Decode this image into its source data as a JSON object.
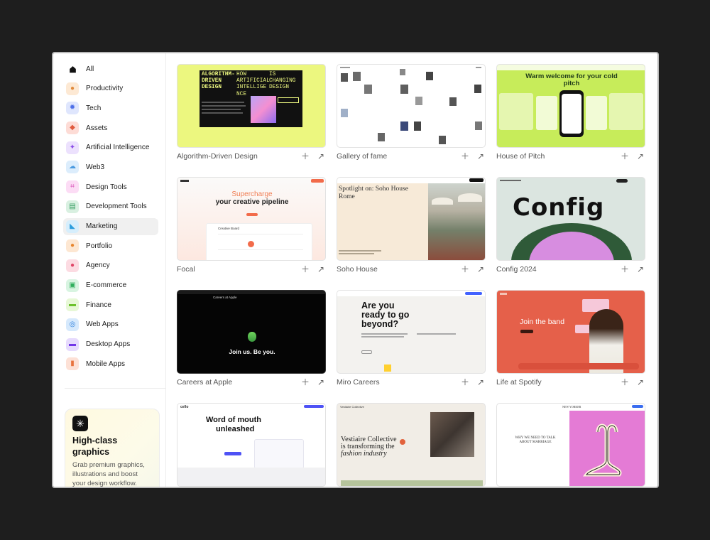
{
  "sidebar": {
    "categories": [
      {
        "label": "All",
        "icon": "home-icon",
        "color": "#111111"
      },
      {
        "label": "Productivity",
        "icon": "person-icon",
        "color": "#f6c08a"
      },
      {
        "label": "Tech",
        "icon": "chip-icon",
        "color": "#8fa8f5"
      },
      {
        "label": "Assets",
        "icon": "cube-icon",
        "color": "#f29a88"
      },
      {
        "label": "Artificial Intelligence",
        "icon": "sparkle-icon",
        "color": "#b58ef0"
      },
      {
        "label": "Web3",
        "icon": "cloud-icon",
        "color": "#8fc4f0"
      },
      {
        "label": "Design Tools",
        "icon": "frame-icon",
        "color": "#f28bd8"
      },
      {
        "label": "Development Tools",
        "icon": "code-icon",
        "color": "#7fc99c"
      },
      {
        "label": "Marketing",
        "icon": "tag-icon",
        "color": "#73c4f2"
      },
      {
        "label": "Portfolio",
        "icon": "user-icon",
        "color": "#f7b37a"
      },
      {
        "label": "Agency",
        "icon": "group-icon",
        "color": "#f38aa0"
      },
      {
        "label": "E-commerce",
        "icon": "bag-icon",
        "color": "#7fd39a"
      },
      {
        "label": "Finance",
        "icon": "card-icon",
        "color": "#a6e07a"
      },
      {
        "label": "Web Apps",
        "icon": "compass-icon",
        "color": "#6ab0ef"
      },
      {
        "label": "Desktop Apps",
        "icon": "monitor-icon",
        "color": "#9a6af0"
      },
      {
        "label": "Mobile Apps",
        "icon": "phone-icon",
        "color": "#f6a78a"
      }
    ],
    "active_index": 8,
    "promo": {
      "title": "High-class graphics",
      "text": "Grab premium graphics, illustrations and boost your design workflow."
    }
  },
  "cards": [
    {
      "title": "Algorithm-Driven Design"
    },
    {
      "title": "Gallery of fame"
    },
    {
      "title": "House of Pitch"
    },
    {
      "title": "Focal"
    },
    {
      "title": "Soho House"
    },
    {
      "title": "Config 2024"
    },
    {
      "title": "Careers at Apple"
    },
    {
      "title": "Miro Careers"
    },
    {
      "title": "Life at Spotify"
    },
    {
      "title": ""
    },
    {
      "title": ""
    },
    {
      "title": ""
    }
  ],
  "thumbs": {
    "algo": {
      "lines": [
        "ALGORITHM-",
        "DRIVEN",
        "DESIGN"
      ],
      "mid": [
        "HOW",
        "ARTIFICIAL",
        "INTELLIGE",
        "NCE"
      ],
      "right": [
        "IS",
        "CHANGING",
        "DESIGN"
      ]
    },
    "pitch": {
      "headline": "Warm welcome for your cold pitch"
    },
    "focal": {
      "headline1": "Supercharge",
      "headline2": "your creative pipeline",
      "board": "Creative Board"
    },
    "soho": {
      "headline": "Spotlight on: Soho House Rome"
    },
    "apple": {
      "nav": "Careers at Apple",
      "headline": "Join us. Be you."
    },
    "miro": {
      "headline": "Are you ready to go beyond?"
    },
    "spotify": {
      "headline": "Join the band"
    },
    "cello": {
      "logo": "cello",
      "headline1": "Word of mouth",
      "headline2": "unleashed"
    },
    "vestiaire": {
      "brand": "Vestiaire Collective",
      "headline1": "Vestiaire Collective",
      "headline2": "is transforming the",
      "headline3": "fashion industry"
    },
    "marriage": {
      "brand": "NEW YORKER",
      "headline": "WHY WE NEED TO TALK ABOUT MARRIAGE"
    }
  },
  "colors": {
    "algo_bg": "#ecf77f",
    "pitch_bg": "#c7ec5a",
    "config_bg": "#dbe5e0",
    "spotify_bg": "#e5604a",
    "marriage_pink": "#e47bd5"
  },
  "icons": {
    "add": "plus-icon",
    "open": "arrow-up-right-icon"
  }
}
